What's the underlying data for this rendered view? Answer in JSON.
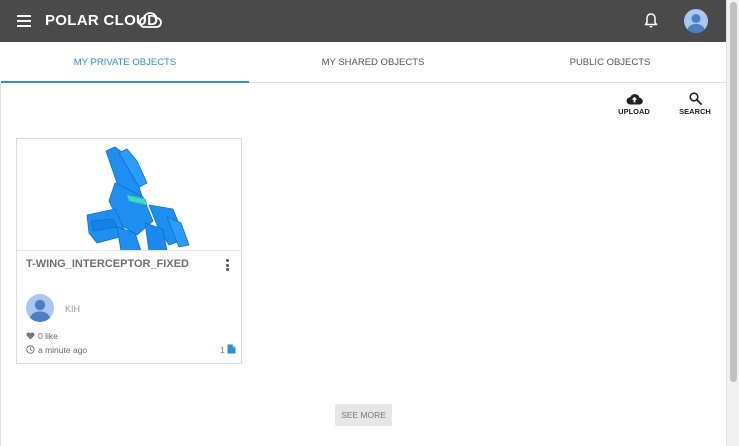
{
  "header": {
    "logo_text": "POLAR CLOUD"
  },
  "tabs": [
    {
      "label": "MY PRIVATE OBJECTS",
      "active": true
    },
    {
      "label": "MY SHARED OBJECTS",
      "active": false
    },
    {
      "label": "PUBLIC OBJECTS",
      "active": false
    }
  ],
  "actions": {
    "upload_label": "UPLOAD",
    "search_label": "SEARCH"
  },
  "objects": [
    {
      "title": "T-WING_INTERCEPTOR_FIXED",
      "owner": "KIH",
      "likes": "0 like",
      "time": "a minute ago",
      "file_count": "1"
    }
  ],
  "footer": {
    "see_more_label": "SEE MORE"
  },
  "colors": {
    "topbar": "#4a4a4a",
    "accent": "#2d8fd5",
    "model": "#1e90ff"
  }
}
